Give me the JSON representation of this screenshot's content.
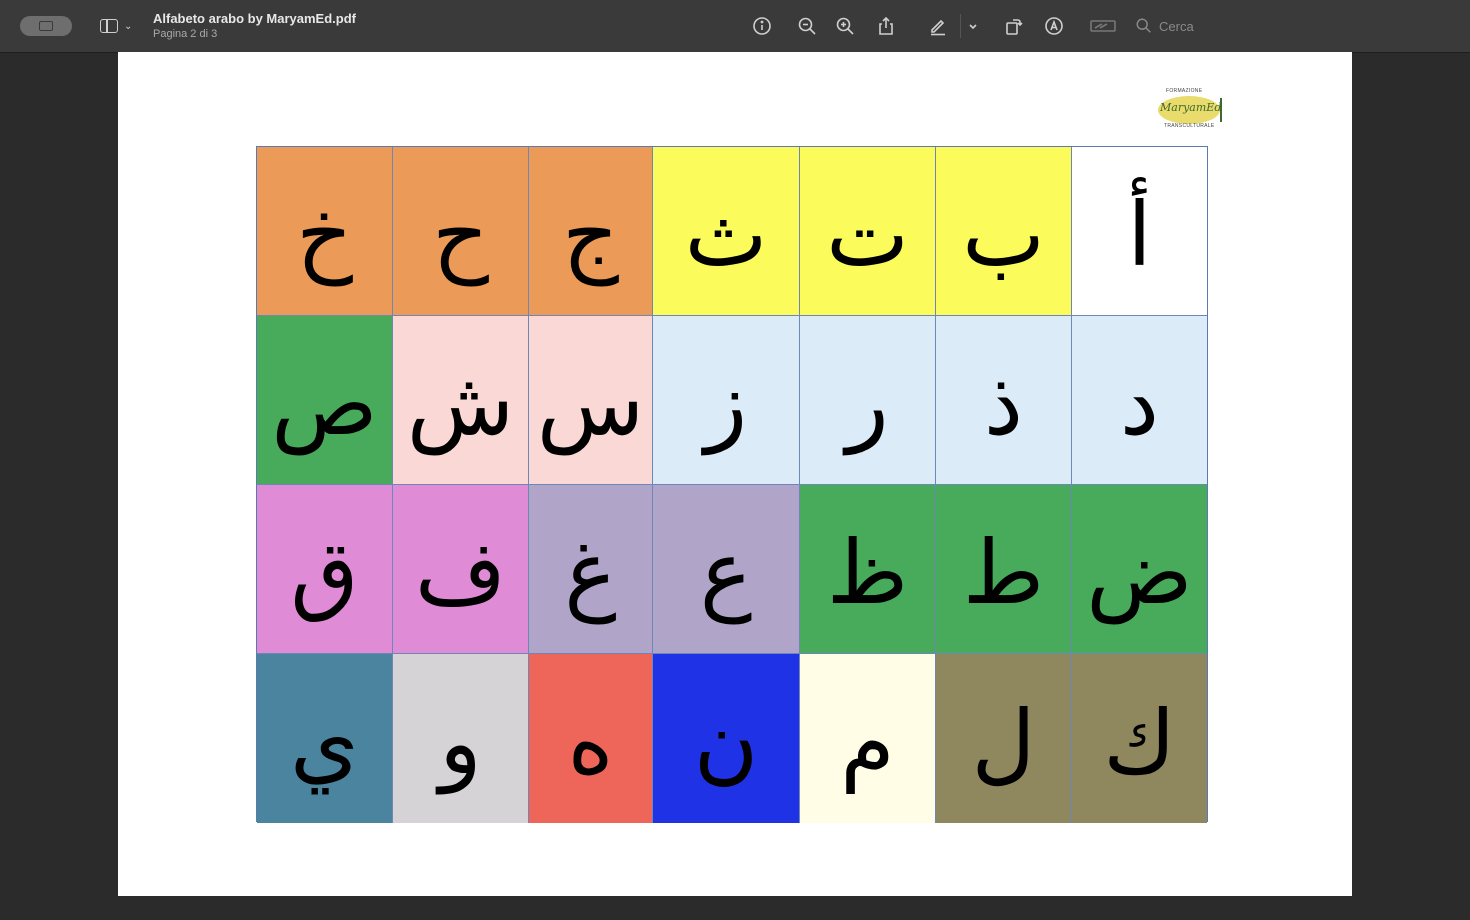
{
  "toolbar": {
    "title": "Alfabeto arabo by MaryamEd.pdf",
    "subtitle": "Pagina 2 di 3",
    "search_placeholder": "Cerca",
    "icons": [
      "window-icon",
      "sidebar-icon",
      "chevron-down-icon",
      "info-icon",
      "zoom-out-icon",
      "zoom-in-icon",
      "share-icon",
      "markup-pen-icon",
      "chevron-down-icon",
      "rotate-icon",
      "annotate-icon",
      "form-fill-icon",
      "search-icon"
    ]
  },
  "logo": {
    "brand": "MaryamEd",
    "top_text": "FORMAZIONE",
    "bottom_text": "TRANSCULTURALE"
  },
  "colors": {
    "orange": "#ec9a58",
    "yellow": "#fbfb5c",
    "white": "#ffffff",
    "green": "#47ab5b",
    "pink": "#f9d8d6",
    "lightblue": "#dbebf7",
    "magenta": "#e08bd6",
    "lavender": "#b0a5c8",
    "steelblue": "#4a849e",
    "grey": "#d5d3d6",
    "salmon": "#ee6559",
    "blue": "#1f32e5",
    "cream": "#fffde6",
    "olive": "#8f875d"
  },
  "grid": {
    "rows": [
      [
        {
          "letter": "خ",
          "color": "#ec9a58"
        },
        {
          "letter": "ح",
          "color": "#ec9a58"
        },
        {
          "letter": "ج",
          "color": "#ec9a58"
        },
        {
          "letter": "ث",
          "color": "#fbfb5c"
        },
        {
          "letter": "ت",
          "color": "#fbfb5c"
        },
        {
          "letter": "ب",
          "color": "#fbfb5c"
        },
        {
          "letter": "أ",
          "color": "#ffffff"
        }
      ],
      [
        {
          "letter": "ص",
          "color": "#47ab5b"
        },
        {
          "letter": "ش",
          "color": "#f9d8d6"
        },
        {
          "letter": "س",
          "color": "#f9d8d6"
        },
        {
          "letter": "ز",
          "color": "#dbebf7"
        },
        {
          "letter": "ر",
          "color": "#dbebf7"
        },
        {
          "letter": "ذ",
          "color": "#dbebf7"
        },
        {
          "letter": "د",
          "color": "#dbebf7"
        }
      ],
      [
        {
          "letter": "ق",
          "color": "#e08bd6"
        },
        {
          "letter": "ف",
          "color": "#e08bd6"
        },
        {
          "letter": "غ",
          "color": "#b0a5c8"
        },
        {
          "letter": "ع",
          "color": "#b0a5c8"
        },
        {
          "letter": "ظ",
          "color": "#47ab5b"
        },
        {
          "letter": "ط",
          "color": "#47ab5b"
        },
        {
          "letter": "ض",
          "color": "#47ab5b"
        }
      ],
      [
        {
          "letter": "ي",
          "color": "#4a849e"
        },
        {
          "letter": "و",
          "color": "#d5d3d6"
        },
        {
          "letter": "ه",
          "color": "#ee6559"
        },
        {
          "letter": "ن",
          "color": "#1f32e5"
        },
        {
          "letter": "م",
          "color": "#fffde6"
        },
        {
          "letter": "ل",
          "color": "#8f875d"
        },
        {
          "letter": "ك",
          "color": "#8f875d"
        }
      ]
    ]
  }
}
